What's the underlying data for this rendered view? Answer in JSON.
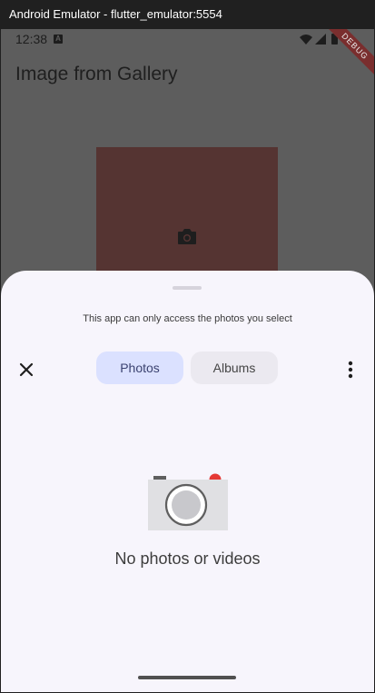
{
  "window": {
    "title": "Android Emulator - flutter_emulator:5554"
  },
  "statusbar": {
    "time": "12:38",
    "notification_icon": "A",
    "debug_banner": "DEBUG",
    "icons": [
      "wifi-icon",
      "signal-icon",
      "battery-icon"
    ]
  },
  "app": {
    "title": "Image from Gallery",
    "placeholder_icon": "camera-icon",
    "placeholder_color": "#553432"
  },
  "picker": {
    "info": "This app can only access the photos you select",
    "close_icon": "close-icon",
    "tabs": [
      {
        "label": "Photos",
        "selected": true
      },
      {
        "label": "Albums",
        "selected": false
      }
    ],
    "more_icon": "more-vertical-icon",
    "empty_icon": "camera-illustration-icon",
    "empty_message": "No photos or videos"
  },
  "colors": {
    "sheet_background": "#f7f5fc",
    "selected_tab": "#dbe1ff",
    "unselected_tab": "#ebe9f0",
    "camera_accent": "#e53935"
  }
}
